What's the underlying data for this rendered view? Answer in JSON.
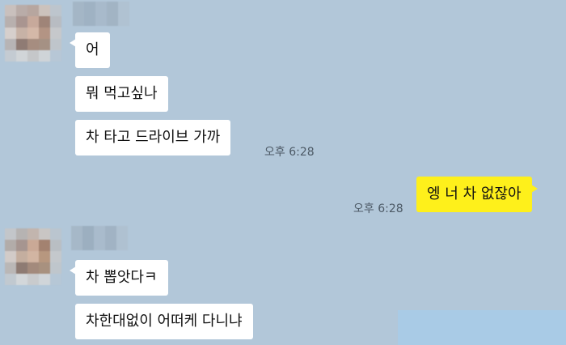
{
  "colors": {
    "background": "#b2c7d9",
    "received_bubble": "#ffffff",
    "sent_bubble": "#fef01b",
    "timestamp_text": "#4d5a66"
  },
  "messages": [
    {
      "sender": "other",
      "text": "어"
    },
    {
      "sender": "other",
      "text": "뭐 먹고싶나"
    },
    {
      "sender": "other",
      "text": "차 타고 드라이브 가까",
      "time": "오후 6:28"
    },
    {
      "sender": "me",
      "text": "엥 너 차 없잖아",
      "time": "오후 6:28"
    },
    {
      "sender": "other",
      "text": "차 뽑앗다ㅋ"
    },
    {
      "sender": "other",
      "text": "차한대없이 어떠케 다니냐"
    }
  ],
  "icons": {
    "avatar_1": "blurred-profile-photo",
    "avatar_2": "blurred-profile-photo"
  }
}
